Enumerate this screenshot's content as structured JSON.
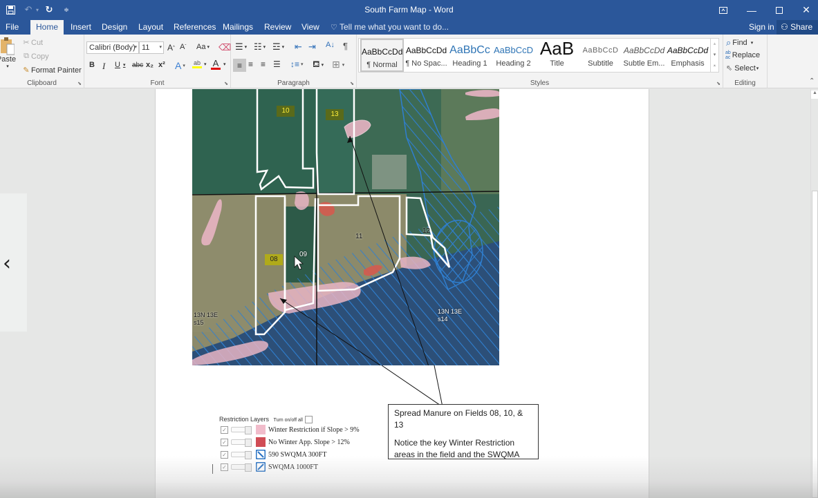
{
  "window": {
    "title": "South Farm Map - Word",
    "controls": [
      "ribbon-display-options",
      "minimize",
      "maximize",
      "close"
    ]
  },
  "quick_access": {
    "save": "save-icon",
    "undo": "undo-icon",
    "redo": "redo-icon",
    "customize": "customize-icon"
  },
  "tabs": [
    {
      "label": "File",
      "active": false
    },
    {
      "label": "Home",
      "active": true
    },
    {
      "label": "Insert",
      "active": false
    },
    {
      "label": "Design",
      "active": false
    },
    {
      "label": "Layout",
      "active": false
    },
    {
      "label": "References",
      "active": false
    },
    {
      "label": "Mailings",
      "active": false
    },
    {
      "label": "Review",
      "active": false
    },
    {
      "label": "View",
      "active": false
    }
  ],
  "tell_me": "Tell me what you want to do...",
  "account": {
    "sign_in": "Sign in",
    "share": "Share"
  },
  "ribbon": {
    "clipboard": {
      "label": "Clipboard",
      "paste": "Paste",
      "cut": "Cut",
      "copy": "Copy",
      "format_painter": "Format Painter"
    },
    "font": {
      "label": "Font",
      "font_name": "Calibri (Body)",
      "font_size": "11",
      "grow": "A",
      "shrink": "A",
      "change_case": "Aa",
      "bold": "B",
      "italic": "I",
      "underline": "U",
      "strikethrough": "abc",
      "subscript": "x₂",
      "superscript": "x²",
      "text_effects": "A",
      "highlight": "ab",
      "font_color": "A",
      "highlight_color": "#ffff00",
      "font_color_value": "#e00000"
    },
    "paragraph": {
      "label": "Paragraph",
      "show_marks": "¶"
    },
    "styles": {
      "label": "Styles",
      "items": [
        {
          "preview": "AaBbCcDd",
          "name": "¶ Normal",
          "selected": true
        },
        {
          "preview": "AaBbCcDd",
          "name": "¶ No Spac...",
          "selected": false
        },
        {
          "preview": "AaBbCc",
          "name": "Heading 1",
          "selected": false
        },
        {
          "preview": "AaBbCcD",
          "name": "Heading 2",
          "selected": false
        },
        {
          "preview": "AaB",
          "name": "Title",
          "selected": false
        },
        {
          "preview": "AaBbCcD",
          "name": "Subtitle",
          "selected": false
        },
        {
          "preview": "AaBbCcDd",
          "name": "Subtle Em...",
          "selected": false
        },
        {
          "preview": "AaBbCcDd",
          "name": "Emphasis",
          "selected": false
        }
      ]
    },
    "editing": {
      "label": "Editing",
      "find": "Find",
      "replace": "Replace",
      "select": "Select"
    }
  },
  "document": {
    "map": {
      "field_labels": [
        "10",
        "13",
        "08",
        "09",
        "11",
        "12"
      ],
      "section_labels": [
        {
          "line1": "13N 13E",
          "line2": "s15"
        },
        {
          "line1": "13N 13E",
          "line2": "s14"
        }
      ],
      "colors": {
        "winter_restriction": "#e8b4c3",
        "no_winter_app": "#d9534f",
        "swqma_hatch": "#2f7fd0",
        "field_outline": "#ffffff"
      }
    },
    "callout": {
      "line1": "Spread Manure on Fields 08, 10, & 13",
      "line2": "Notice the key Winter Restriction",
      "line3": "areas in the field and the SWQMA"
    },
    "legend": {
      "title": "Restriction Layers",
      "toggle_all": "Turn on/off all",
      "layers": [
        {
          "label": "Winter Restriction if Slope > 9%",
          "checked": true,
          "color": "#f1bccb",
          "icon": "pink-swatch"
        },
        {
          "label": "No Winter App. Slope > 12%",
          "checked": true,
          "color": "#d04c55",
          "icon": "red-swatch"
        },
        {
          "label": "590 SWQMA 300FT",
          "checked": true,
          "color": "#2a73c4",
          "icon": "hatch-swatch"
        },
        {
          "label": "SWQMA 1000FT",
          "checked": true,
          "color": "#2a73c4",
          "icon": "hatch-swatch"
        }
      ]
    }
  }
}
